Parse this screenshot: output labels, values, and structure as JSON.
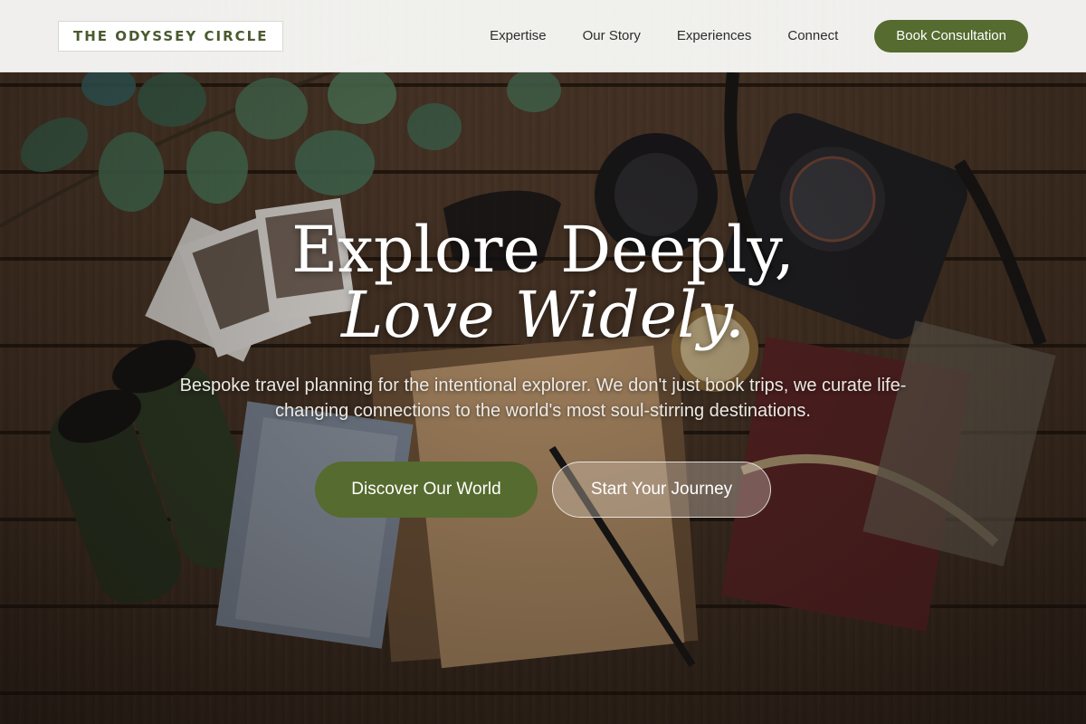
{
  "header": {
    "logo": "THE ODYSSEY CIRCLE",
    "nav": [
      {
        "label": "Expertise"
      },
      {
        "label": "Our Story"
      },
      {
        "label": "Experiences"
      },
      {
        "label": "Connect"
      }
    ],
    "cta_label": "Book Consultation"
  },
  "hero": {
    "headline_line1": "Explore Deeply,",
    "headline_line2": "Love Widely.",
    "subtitle": "Bespoke travel planning for the intentional explorer. We don't just book trips, we curate life-changing connections to the world's most soul-stirring destinations.",
    "primary_button": "Discover Our World",
    "secondary_button": "Start Your Journey"
  },
  "colors": {
    "accent_green": "#566b2f",
    "header_bg": "#f8f8f6",
    "logo_text": "#4a5a2e"
  }
}
